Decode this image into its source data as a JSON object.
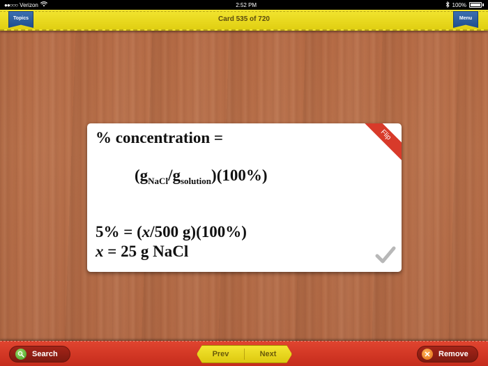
{
  "status_bar": {
    "carrier": "Verizon",
    "time": "2:52 PM",
    "battery": "100%"
  },
  "top_bar": {
    "topics_label": "Topics",
    "card_counter": "Card 535 of 720",
    "menu_label": "Menu"
  },
  "card": {
    "line1": "% concentration =",
    "line2_open": "(g",
    "line2_sub1": "NaCl",
    "line2_mid": "/g",
    "line2_sub2": "solution",
    "line2_close": ")(100%)",
    "line3_a": "5% = (",
    "line3_var": "x",
    "line3_b": "/500 g)(100%)",
    "line4_var": "x",
    "line4_b": " = 25 g NaCl",
    "flip_label": "Flip"
  },
  "bottom_bar": {
    "search_label": "Search",
    "prev_label": "Prev",
    "next_label": "Next",
    "remove_label": "Remove"
  },
  "colors": {
    "top_bar": "#e8da1e",
    "bottom_bar": "#d5391f",
    "topics_button": "#2a5c9e",
    "flip_ribbon": "#d83a2a",
    "wood": "#b56a44"
  }
}
